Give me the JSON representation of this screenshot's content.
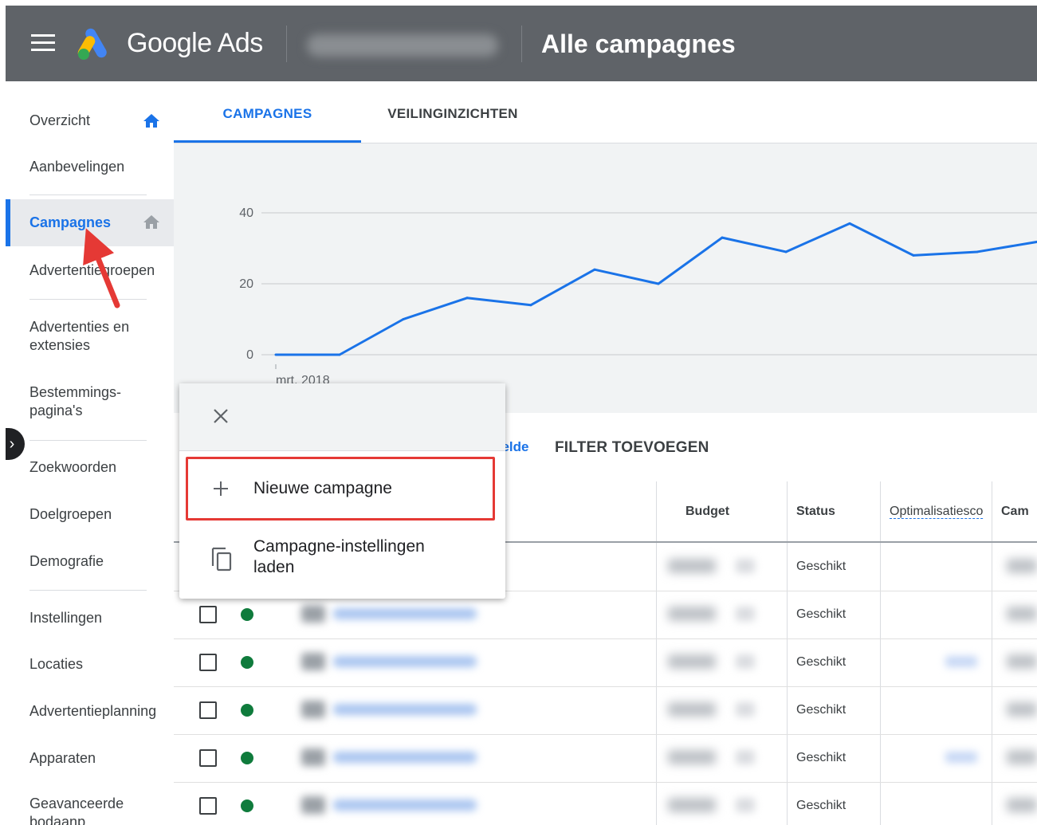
{
  "header": {
    "brand": "Google Ads",
    "page_title": "Alle campagnes"
  },
  "sidebar": {
    "items": [
      {
        "label": "Overzicht"
      },
      {
        "label": "Aanbevelingen"
      },
      {
        "label": "Campagnes"
      },
      {
        "label": "Advertentiegroepen"
      },
      {
        "label": "Advertenties en extensies"
      },
      {
        "label": "Bestemmings-pagina's"
      },
      {
        "label": "Zoekwoorden"
      },
      {
        "label": "Doelgroepen"
      },
      {
        "label": "Demografie"
      },
      {
        "label": "Instellingen"
      },
      {
        "label": "Locaties"
      },
      {
        "label": "Advertentieplanning"
      },
      {
        "label": "Apparaten"
      },
      {
        "label": "Geavanceerde bodaanp."
      }
    ],
    "active_index": 2
  },
  "tabs": [
    {
      "label": "CAMPAGNES",
      "active": true
    },
    {
      "label": "VEILINGINZICHTEN",
      "active": false
    }
  ],
  "chart_data": {
    "type": "line",
    "x_start_label": "mrt. 2018",
    "yticks": [
      0,
      20,
      40
    ],
    "ylim": [
      0,
      40
    ],
    "values": [
      0,
      0,
      10,
      16,
      14,
      24,
      20,
      33,
      29,
      37,
      28,
      29,
      32
    ],
    "color": "#1a73e8",
    "grid": true
  },
  "toolbar": {
    "partial_link": "kelde",
    "filter_label": "FILTER TOEVOEGEN"
  },
  "table": {
    "columns": [
      "Budget",
      "Status",
      "Optimalisatiescore",
      "Cam"
    ],
    "rows": [
      {
        "status": "Geschikt"
      },
      {
        "status": "Geschikt"
      },
      {
        "status": "Geschikt"
      },
      {
        "status": "Geschikt"
      },
      {
        "status": "Geschikt"
      },
      {
        "status": "Geschikt"
      }
    ]
  },
  "popup": {
    "items": [
      {
        "label": "Nieuwe campagne",
        "icon": "plus-icon"
      },
      {
        "label": "Campagne-instellingen laden",
        "icon": "copy-icon"
      }
    ]
  },
  "colors": {
    "accent": "#1a73e8",
    "header_bg": "#5f6368",
    "status_green": "#0f7b3c",
    "highlight_red": "#e53935"
  }
}
